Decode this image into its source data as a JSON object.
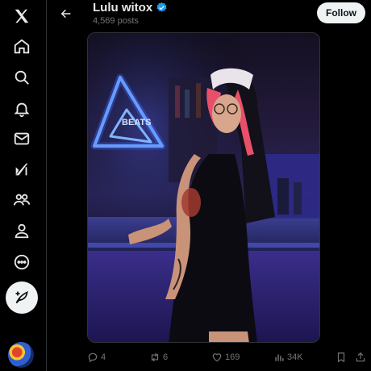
{
  "header": {
    "title": "Lulu witox",
    "posts_count": "4,569 posts",
    "follow_label": "Follow"
  },
  "nav": {
    "items": [
      {
        "icon": "x-logo-icon"
      },
      {
        "icon": "home-icon"
      },
      {
        "icon": "search-icon"
      },
      {
        "icon": "bell-icon"
      },
      {
        "icon": "mail-icon"
      },
      {
        "icon": "grok-icon"
      },
      {
        "icon": "communities-icon"
      },
      {
        "icon": "profile-icon"
      },
      {
        "icon": "more-icon"
      }
    ],
    "compose_icon": "feather-plus-icon"
  },
  "media": {
    "neon_sign_text": "BEATS"
  },
  "actions": {
    "replies": "4",
    "reposts": "6",
    "likes": "169",
    "views": "34K"
  },
  "colors": {
    "background": "#000000",
    "follow_bg": "#eff3f4",
    "verified": "#1d9bf0",
    "muted_text": "#71767b",
    "neon_blue": "#6fa8ff"
  }
}
